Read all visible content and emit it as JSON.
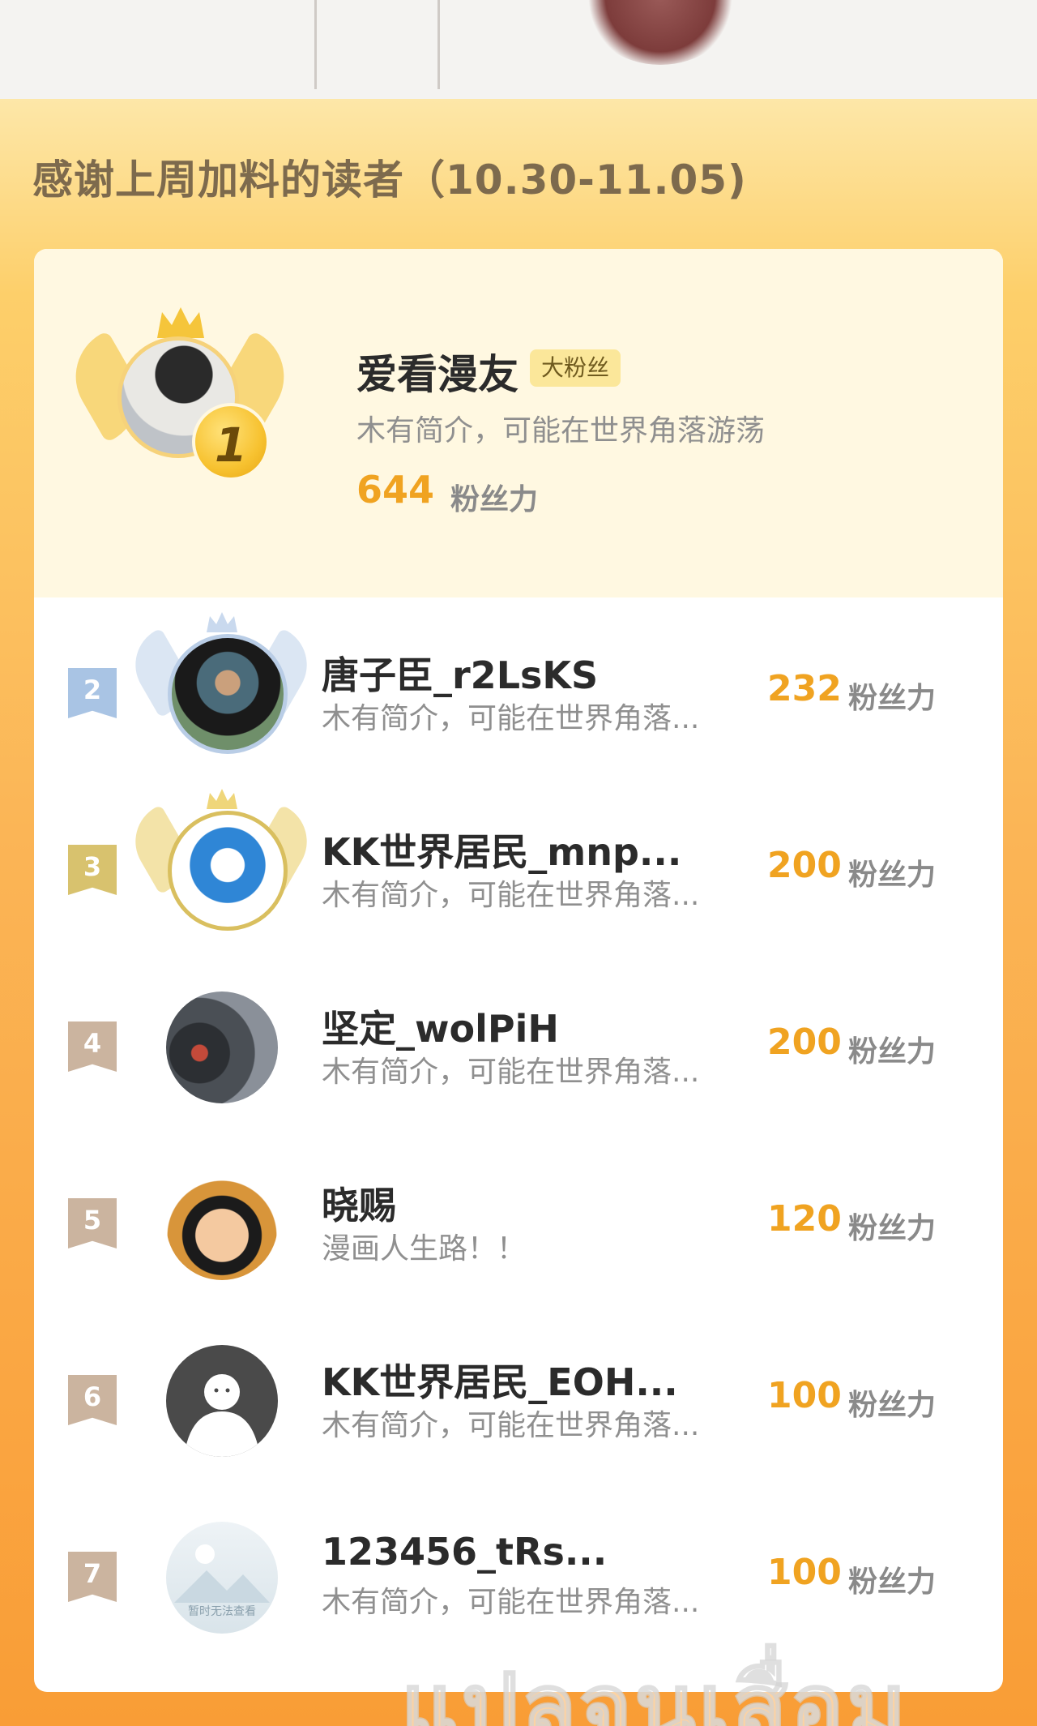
{
  "title": "感谢上周加料的读者（10.30-11.05)",
  "top_fan": {
    "rank": "1",
    "name": "爱看漫友",
    "tag": "大粉丝",
    "bio": "木有简介，可能在世界角落游荡",
    "score": "644",
    "unit": "粉丝力"
  },
  "fans": [
    {
      "rank": "2",
      "name": "唐子臣_r2LsKS",
      "bio": "木有简介，可能在世界角落...",
      "score": "232",
      "unit": "粉丝力",
      "flag_color": "#a9c4e4"
    },
    {
      "rank": "3",
      "name": "KK世界居民_mnp...",
      "bio": "木有简介，可能在世界角落...",
      "score": "200",
      "unit": "粉丝力",
      "flag_color": "#d8c26e"
    },
    {
      "rank": "4",
      "name": "坚定_wolPiH",
      "bio": "木有简介，可能在世界角落...",
      "score": "200",
      "unit": "粉丝力",
      "flag_color": "#cbb49f"
    },
    {
      "rank": "5",
      "name": "晓赐",
      "bio": "漫画人生路！！",
      "score": "120",
      "unit": "粉丝力",
      "flag_color": "#cbb49f"
    },
    {
      "rank": "6",
      "name": "KK世界居民_EOH...",
      "bio": "木有简介，可能在世界角落...",
      "score": "100",
      "unit": "粉丝力",
      "flag_color": "#cbb49f"
    },
    {
      "rank": "7",
      "name": "123456_tRs...",
      "bio": "木有简介，可能在世界角落...",
      "score": "100",
      "unit": "粉丝力",
      "flag_color": "#cbb49f"
    }
  ],
  "placeholder_avatar_text": "暂时无法查看",
  "watermark": "แปลจนเสื่อม",
  "colors": {
    "accent": "#f0a321",
    "panel_top": "#fde7a8",
    "panel_bottom": "#f99d36"
  }
}
